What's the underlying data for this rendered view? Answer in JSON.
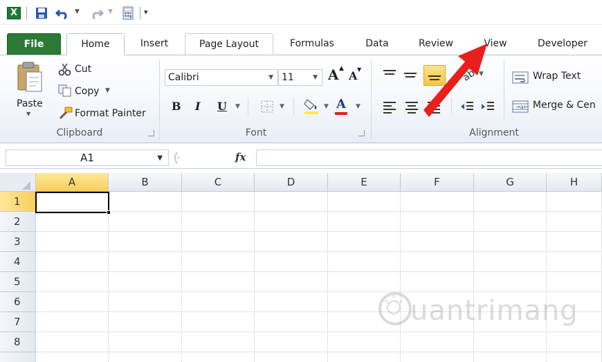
{
  "tabs": [
    {
      "label": "File"
    },
    {
      "label": "Home"
    },
    {
      "label": "Insert"
    },
    {
      "label": "Page Layout"
    },
    {
      "label": "Formulas"
    },
    {
      "label": "Data"
    },
    {
      "label": "Review"
    },
    {
      "label": "View"
    },
    {
      "label": "Developer"
    }
  ],
  "clipboard": {
    "paste": "Paste",
    "cut": "Cut",
    "copy": "Copy",
    "format_painter": "Format Painter",
    "group_label": "Clipboard"
  },
  "font": {
    "font_name": "Calibri",
    "font_size": "11",
    "bold": "B",
    "italic": "I",
    "underline": "U",
    "font_color_letter": "A",
    "grow_letter": "A",
    "shrink_letter": "A",
    "group_label": "Font"
  },
  "alignment": {
    "wrap_text": "Wrap Text",
    "merge_center": "Merge & Cen",
    "group_label": "Alignment"
  },
  "formula_bar": {
    "name_box": "A1",
    "fx": "fx"
  },
  "grid": {
    "columns": [
      "A",
      "B",
      "C",
      "D",
      "E",
      "F",
      "G",
      "H"
    ],
    "rows": [
      "1",
      "2",
      "3",
      "4",
      "5",
      "6",
      "7",
      "8"
    ],
    "selected_cell": "A1"
  },
  "watermark": {
    "text": "uantrimang"
  },
  "colors": {
    "file_tab": "#2c7a35",
    "selection_header": "#f8cf5d",
    "arrow": "#e8201d",
    "highlight": "#ffeb3b",
    "font_red": "#e02020"
  }
}
